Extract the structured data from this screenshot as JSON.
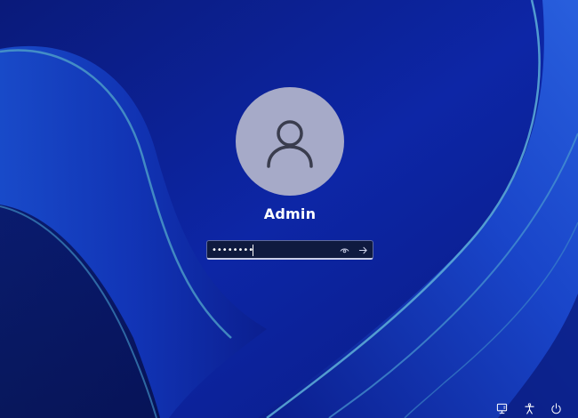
{
  "user": {
    "name": "Admin",
    "avatar_icon": "person-icon"
  },
  "password": {
    "value": "••••••••",
    "reveal_icon": "eye-icon",
    "submit_icon": "arrow-right-icon"
  },
  "tray": {
    "network_icon": "network-icon",
    "accessibility_icon": "accessibility-icon",
    "power_icon": "power-icon"
  },
  "colors": {
    "background": "#0c1f8a",
    "avatar": "#a6aac8",
    "text": "#ffffff"
  }
}
